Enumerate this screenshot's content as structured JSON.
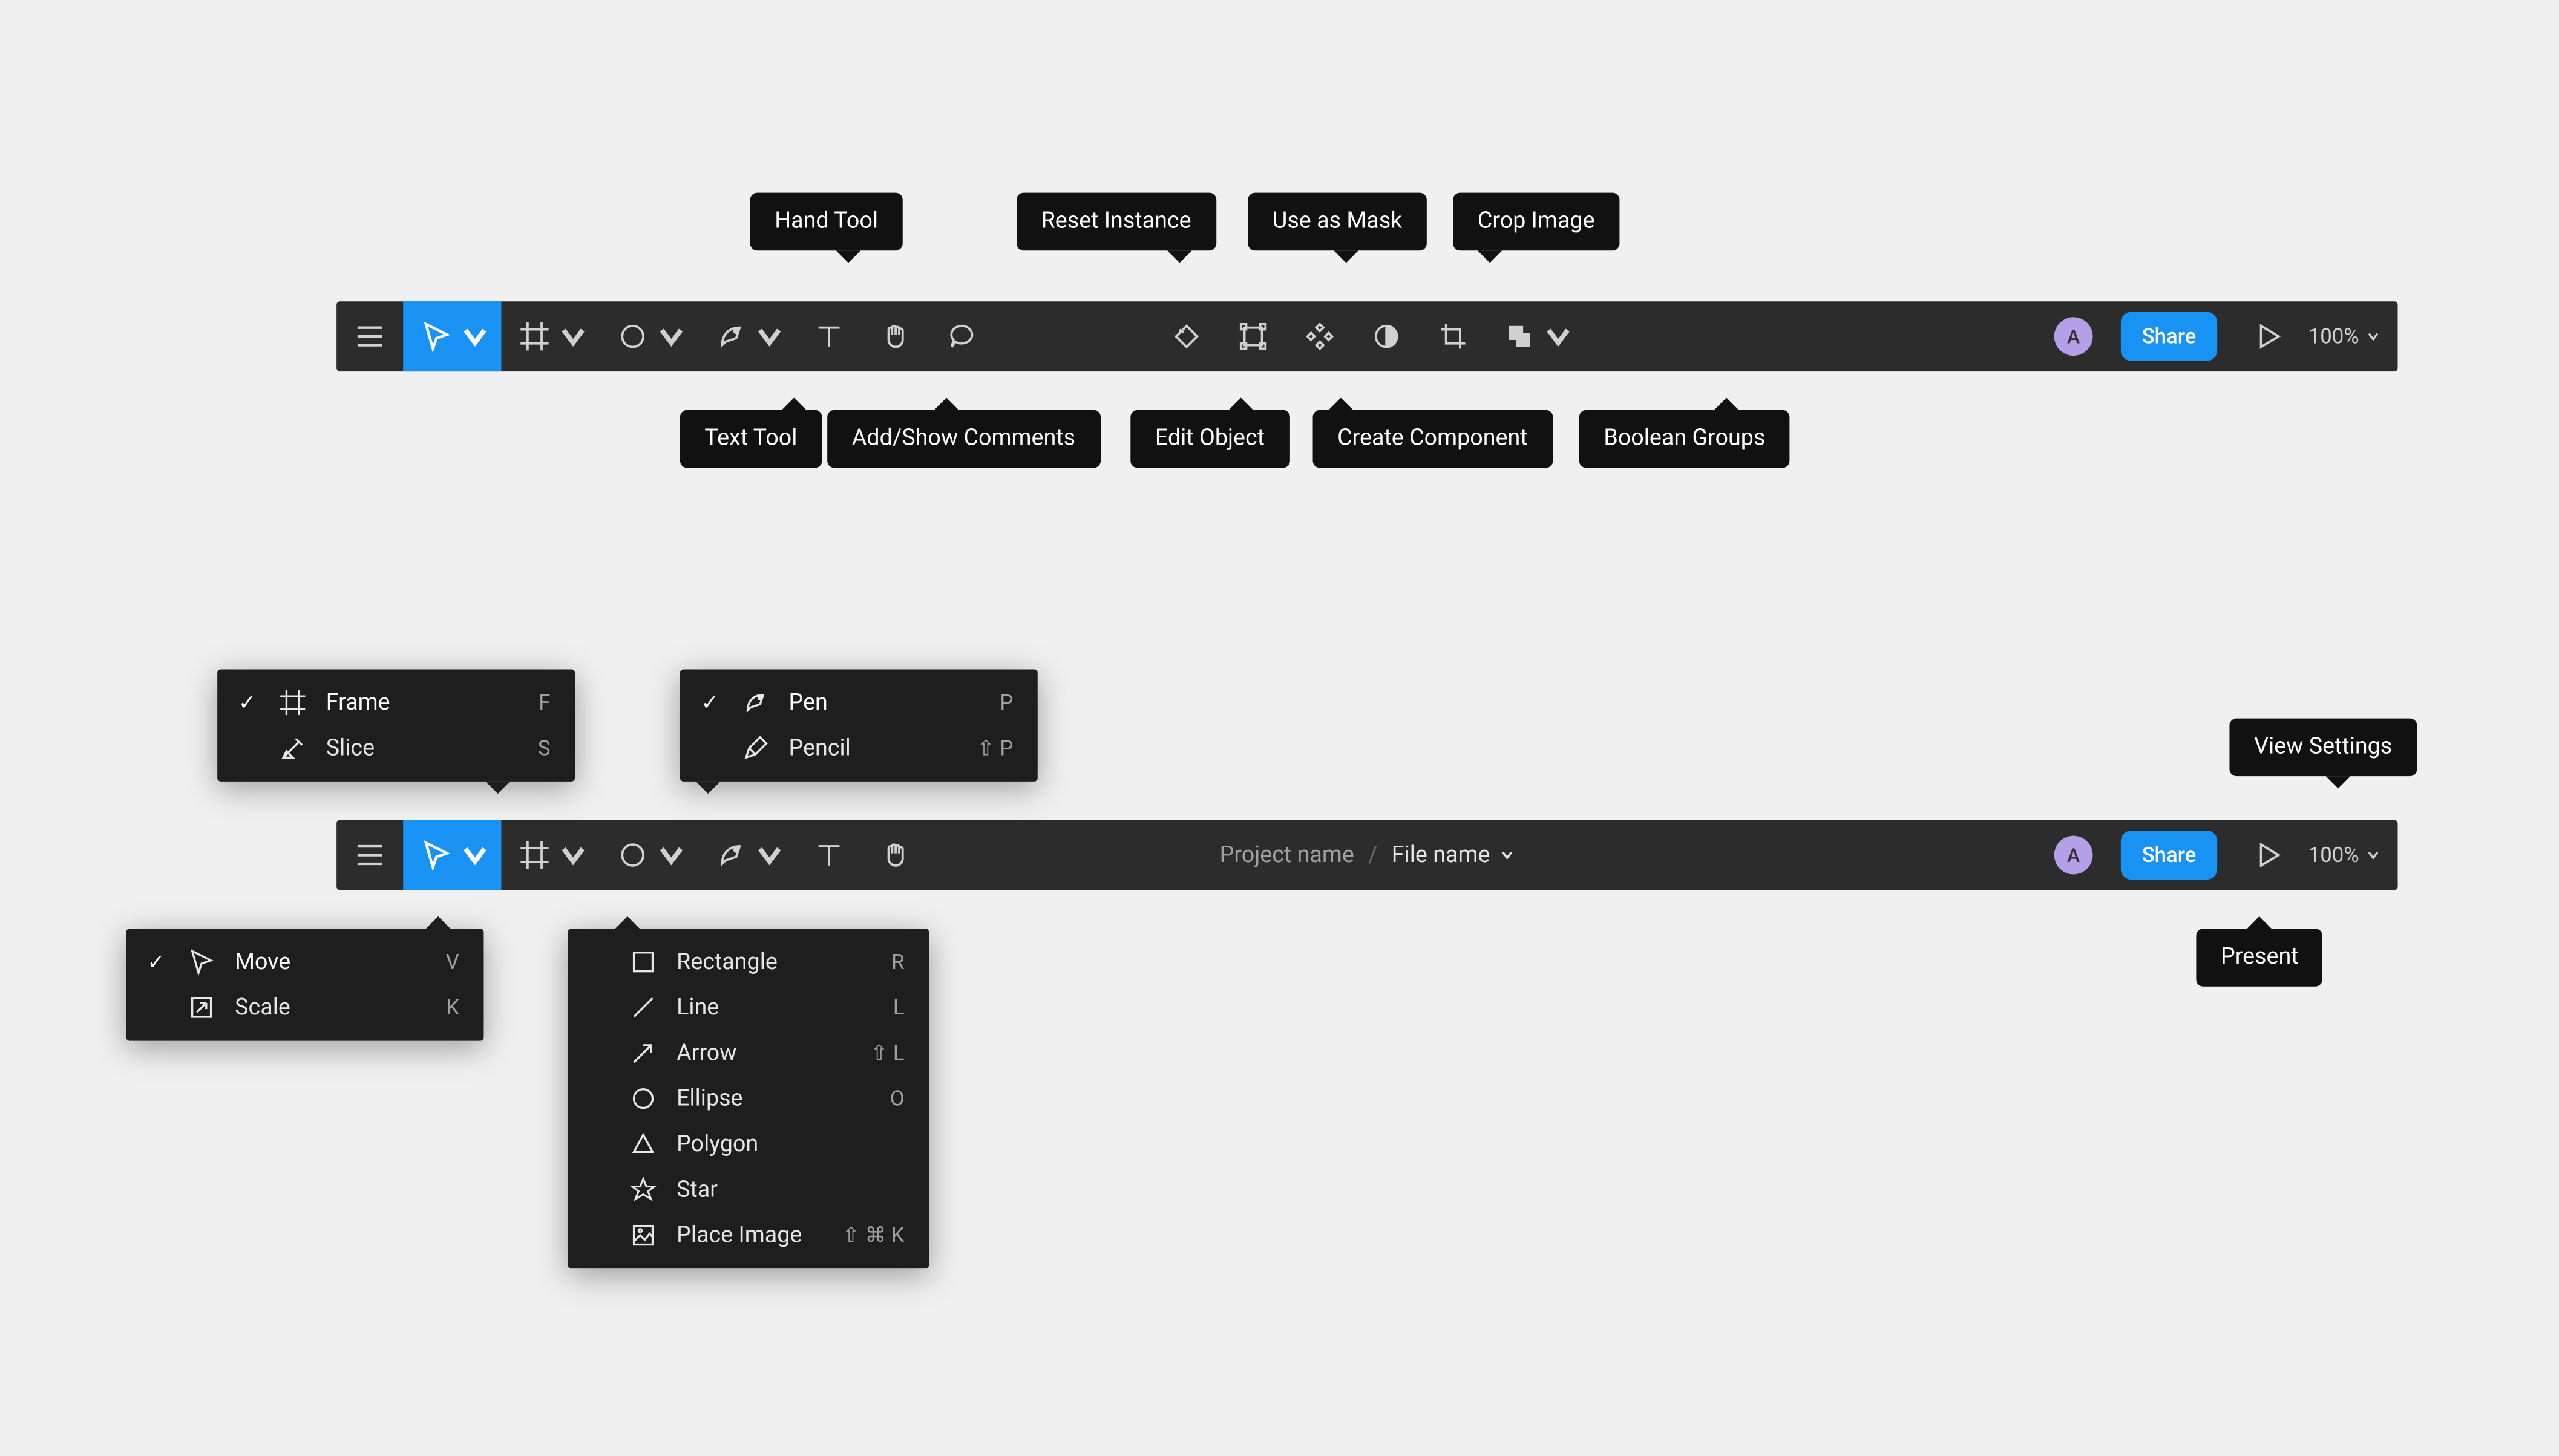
{
  "colors": {
    "accent": "#1893f3",
    "avatar": "#b5a0e8",
    "toolbar": "#2c2c2c",
    "menu": "#1e1e1e",
    "tooltip": "#111111"
  },
  "toolbar1": {
    "tooltips_above": {
      "hand": "Hand Tool",
      "reset": "Reset Instance",
      "mask": "Use as Mask",
      "crop": "Crop Image"
    },
    "tooltips_below": {
      "text": "Text Tool",
      "comments": "Add/Show Comments",
      "edit": "Edit Object",
      "component": "Create Component",
      "boolean": "Boolean Groups"
    },
    "avatar_initial": "A",
    "share_label": "Share",
    "zoom_label": "100%"
  },
  "toolbar2": {
    "breadcrumb": {
      "project": "Project name",
      "file": "File name"
    },
    "avatar_initial": "A",
    "share_label": "Share",
    "zoom_label": "100%",
    "tooltips": {
      "view_settings": "View Settings",
      "present": "Present"
    }
  },
  "menus": {
    "frame": {
      "items": [
        {
          "label": "Frame",
          "key": "F",
          "checked": true,
          "icon": "frame"
        },
        {
          "label": "Slice",
          "key": "S",
          "checked": false,
          "icon": "slice"
        }
      ]
    },
    "pen": {
      "items": [
        {
          "label": "Pen",
          "key": "P",
          "checked": true,
          "icon": "pen"
        },
        {
          "label": "Pencil",
          "key": "⇧ P",
          "checked": false,
          "icon": "pencil"
        }
      ]
    },
    "move": {
      "items": [
        {
          "label": "Move",
          "key": "V",
          "checked": true,
          "icon": "cursor"
        },
        {
          "label": "Scale",
          "key": "K",
          "checked": false,
          "icon": "scale"
        }
      ]
    },
    "shape": {
      "items": [
        {
          "label": "Rectangle",
          "key": "R",
          "icon": "rect"
        },
        {
          "label": "Line",
          "key": "L",
          "icon": "line"
        },
        {
          "label": "Arrow",
          "key": "⇧ L",
          "icon": "arrow"
        },
        {
          "label": "Ellipse",
          "key": "O",
          "icon": "ellipse"
        },
        {
          "label": "Polygon",
          "key": "",
          "icon": "polygon"
        },
        {
          "label": "Star",
          "key": "",
          "icon": "star"
        },
        {
          "label": "Place Image",
          "key": "⇧ ⌘ K",
          "icon": "image"
        }
      ]
    }
  }
}
